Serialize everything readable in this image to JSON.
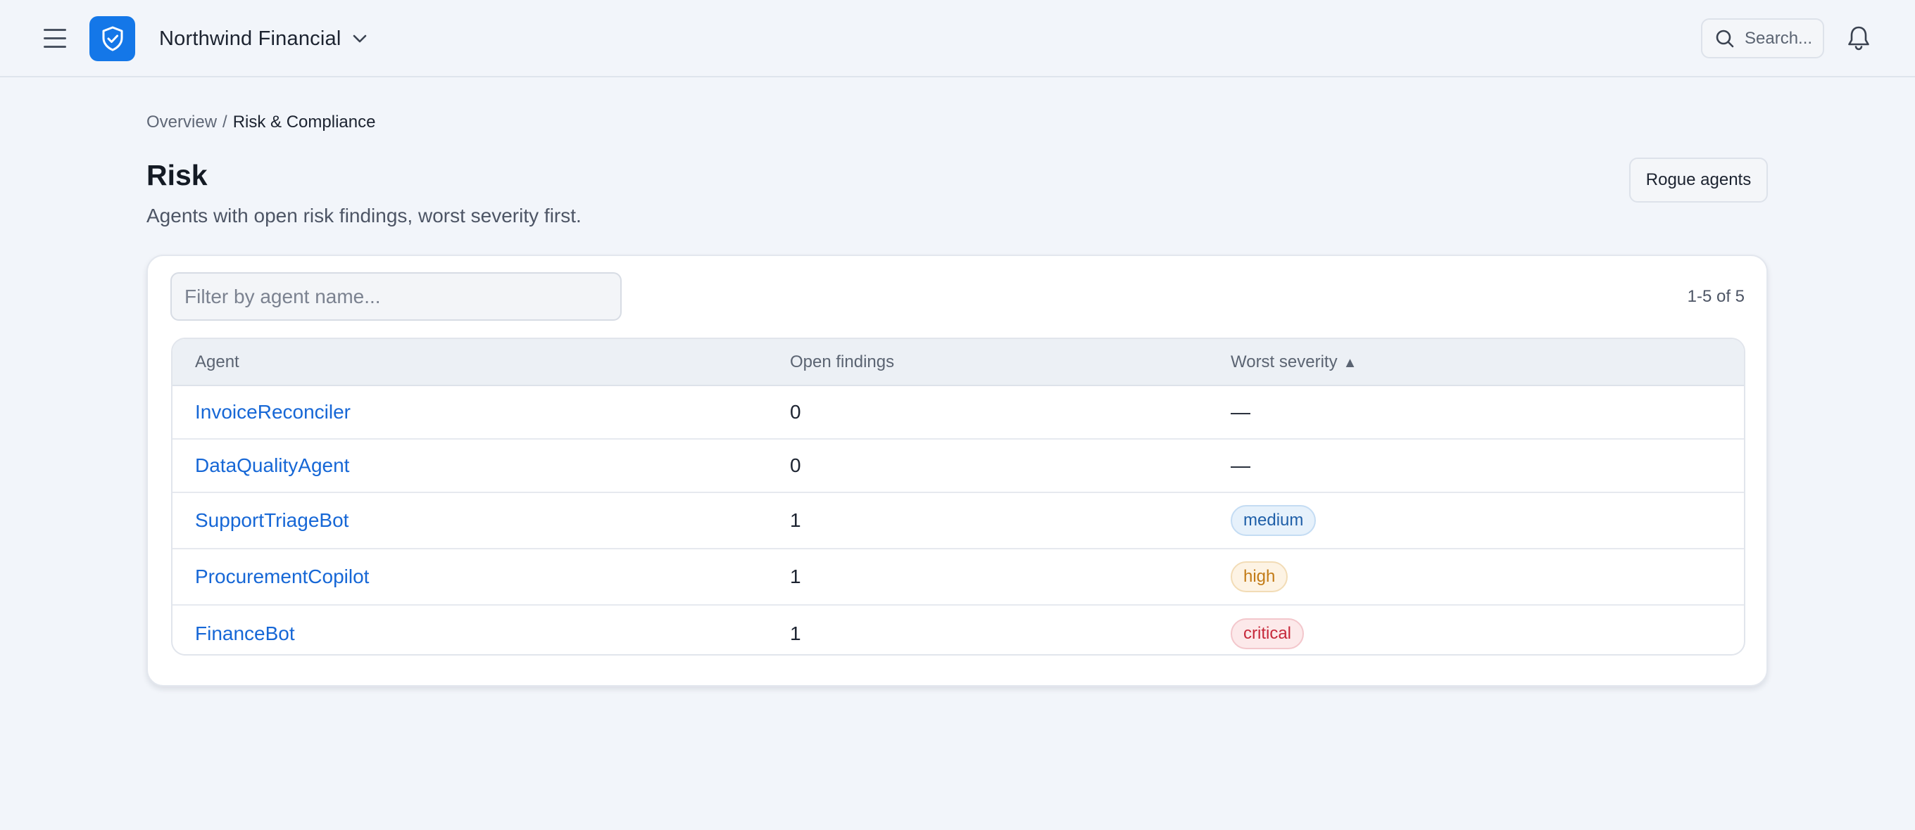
{
  "header": {
    "org_name": "Northwind Financial",
    "search_placeholder": "Search..."
  },
  "breadcrumb": {
    "root": "Overview",
    "separator": "/",
    "current": "Risk & Compliance"
  },
  "page": {
    "title": "Risk",
    "subtitle": "Agents with open risk findings, worst severity first.",
    "rogue_button": "Rogue agents"
  },
  "table": {
    "filter_placeholder": "Filter by agent name...",
    "count": "1-5 of 5",
    "columns": {
      "agent": "Agent",
      "findings": "Open findings",
      "severity": "Worst severity",
      "sort_indicator": "▲"
    },
    "rows": [
      {
        "agent": "InvoiceReconciler",
        "findings": "0",
        "severity": "—"
      },
      {
        "agent": "DataQualityAgent",
        "findings": "0",
        "severity": "—"
      },
      {
        "agent": "SupportTriageBot",
        "findings": "1",
        "severity": "medium"
      },
      {
        "agent": "ProcurementCopilot",
        "findings": "1",
        "severity": "high"
      },
      {
        "agent": "FinanceBot",
        "findings": "1",
        "severity": "critical"
      }
    ]
  },
  "colors": {
    "accent": "#1477e8",
    "link": "#1667d6",
    "medium_text": "#1f5fa8",
    "medium_bg": "#e6f1fb",
    "medium_border": "#c4dcf3",
    "high_text": "#c27b17",
    "high_bg": "#fdf3e4",
    "high_border": "#f2dcb6",
    "critical_text": "#c6283a",
    "critical_bg": "#fce9ea",
    "critical_border": "#f3c7cc"
  },
  "icons": {
    "menu": "menu-icon",
    "logo": "shield-check-icon",
    "org_switch": "chevron-down-icon",
    "search": "search-icon",
    "notifications": "bell-icon"
  }
}
